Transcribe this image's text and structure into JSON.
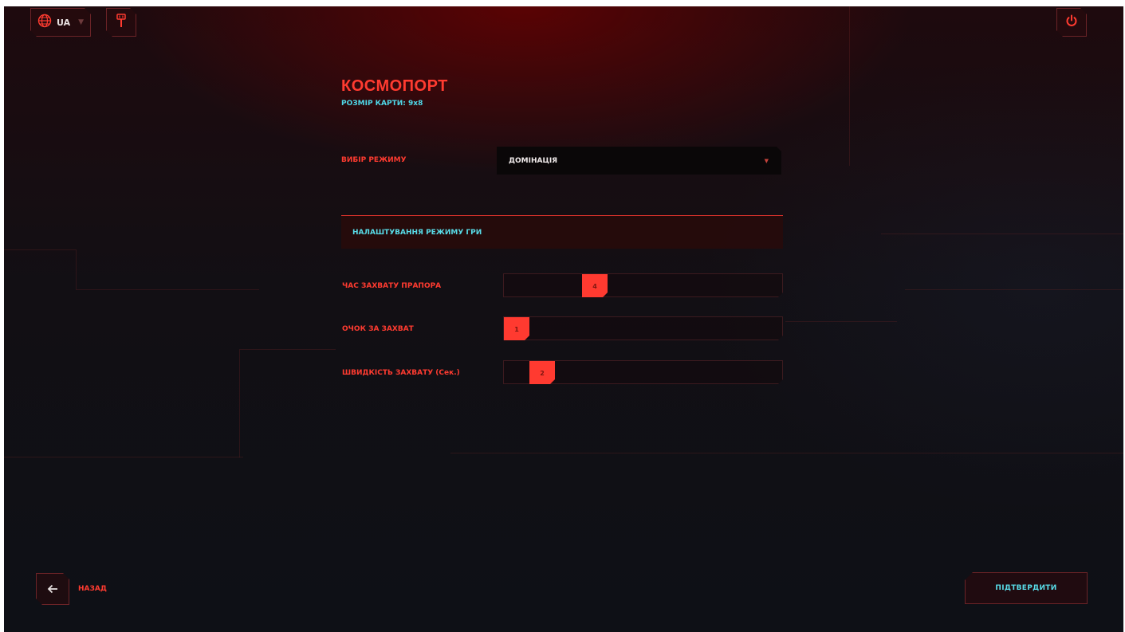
{
  "topbar": {
    "language_code": "UA",
    "icons": {
      "language": "globe-icon",
      "language_caret": "caret-down-icon",
      "tool": "key-tool-icon",
      "power": "power-icon"
    }
  },
  "map": {
    "name": "КОСМОПОРТ",
    "size_label": "РОЗМІР КАРТИ: 9x8"
  },
  "mode_select": {
    "label": "ВИБІР РЕЖИМУ",
    "value": "ДОМІНАЦІЯ"
  },
  "settings": {
    "header": "НАЛАШТУВАННЯ РЕЖИМУ ГРИ",
    "sliders": [
      {
        "label": "ЧАС ЗАХВАТУ ПРАПОРА",
        "value": "4",
        "fraction": 0.31
      },
      {
        "label": "ОЧОК ЗА ЗАХВАТ",
        "value": "1",
        "fraction": 0.0
      },
      {
        "label": "ШВИДКІСТЬ ЗАХВАТУ (Сек.)",
        "value": "2",
        "fraction": 0.1
      }
    ]
  },
  "footer": {
    "back_label": "НАЗАД",
    "confirm_label": "ПІДТВЕРДИТИ"
  },
  "colors": {
    "accent": "#ff3b30",
    "highlight": "#58dce8",
    "background": "#120f14"
  }
}
